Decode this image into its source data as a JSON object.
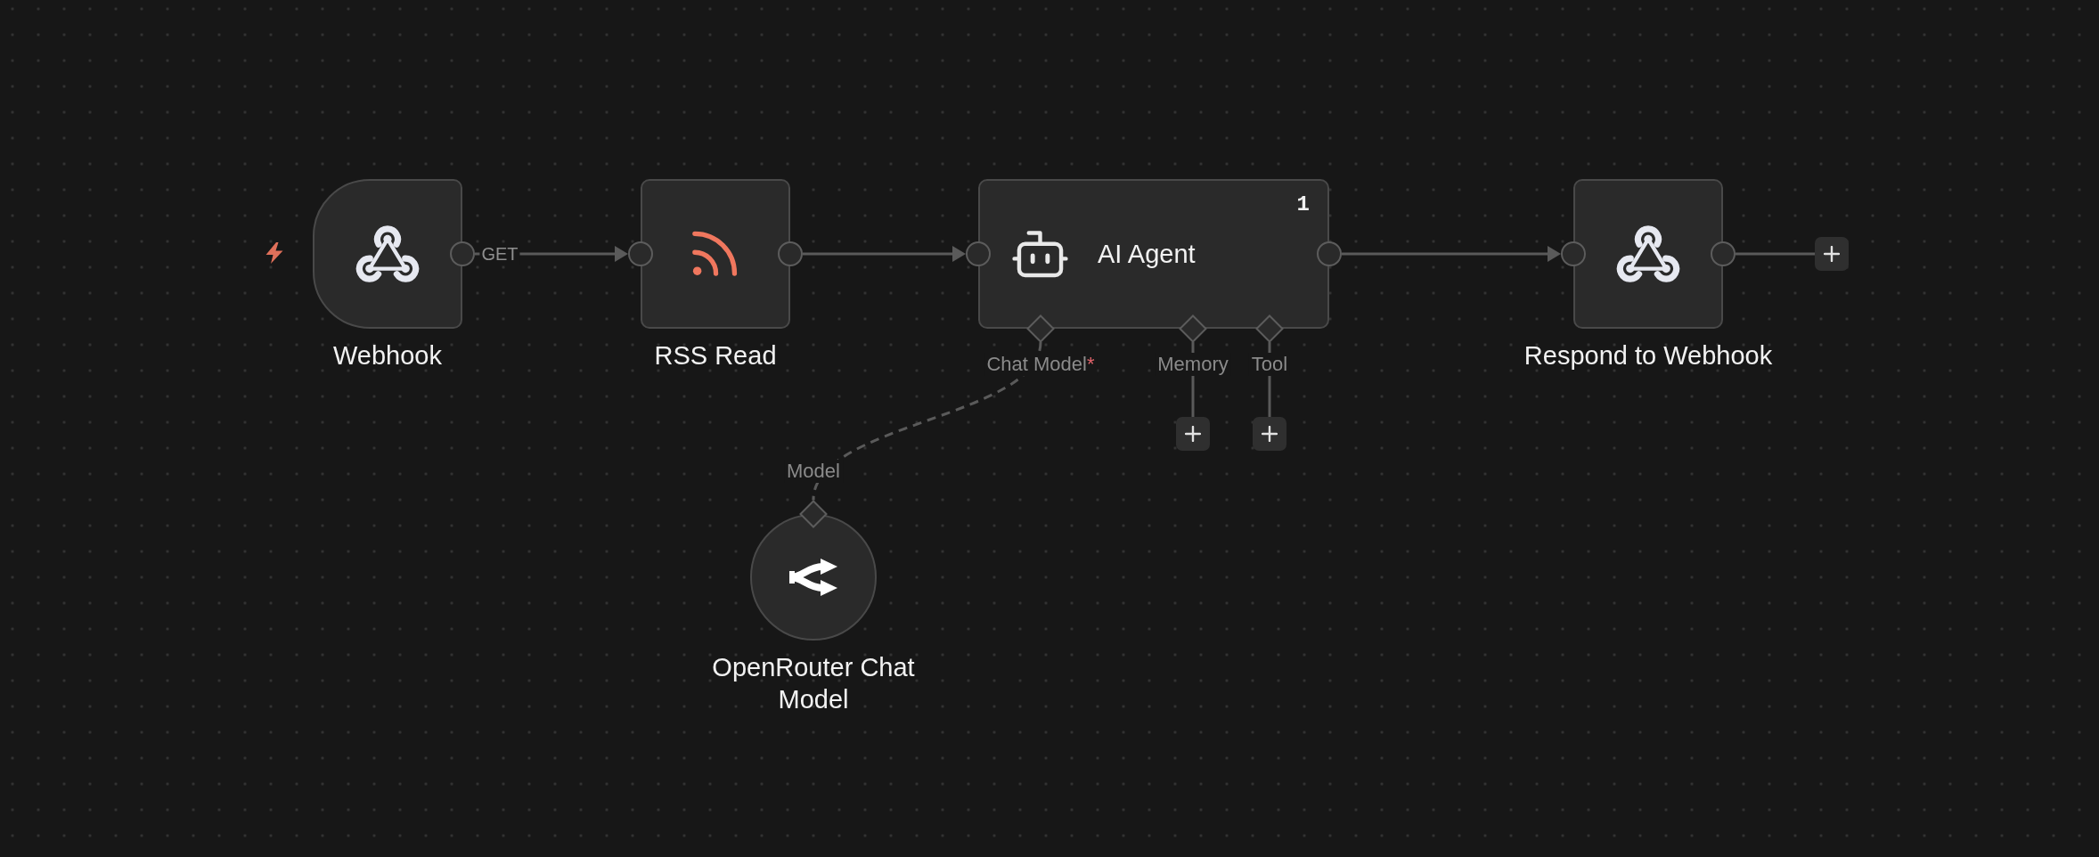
{
  "canvas": {
    "nodes": [
      {
        "kind": "trigger",
        "label": "Webhook",
        "edge_label": "GET",
        "add_next": false
      },
      {
        "kind": "feed",
        "label": "RSS Read",
        "add_next": false
      },
      {
        "kind": "agent",
        "label": "AI Agent",
        "badge": "1",
        "add_next": false,
        "inputs": [
          {
            "label": "Chat Model",
            "required_mark": "*",
            "node": {
              "kind": "model",
              "label": "OpenRouter Chat Model",
              "port_label": "Model"
            }
          },
          {
            "label": "Memory"
          },
          {
            "label": "Tool"
          }
        ]
      },
      {
        "kind": "respond",
        "label": "Respond to Webhook",
        "add_next": true
      }
    ]
  }
}
